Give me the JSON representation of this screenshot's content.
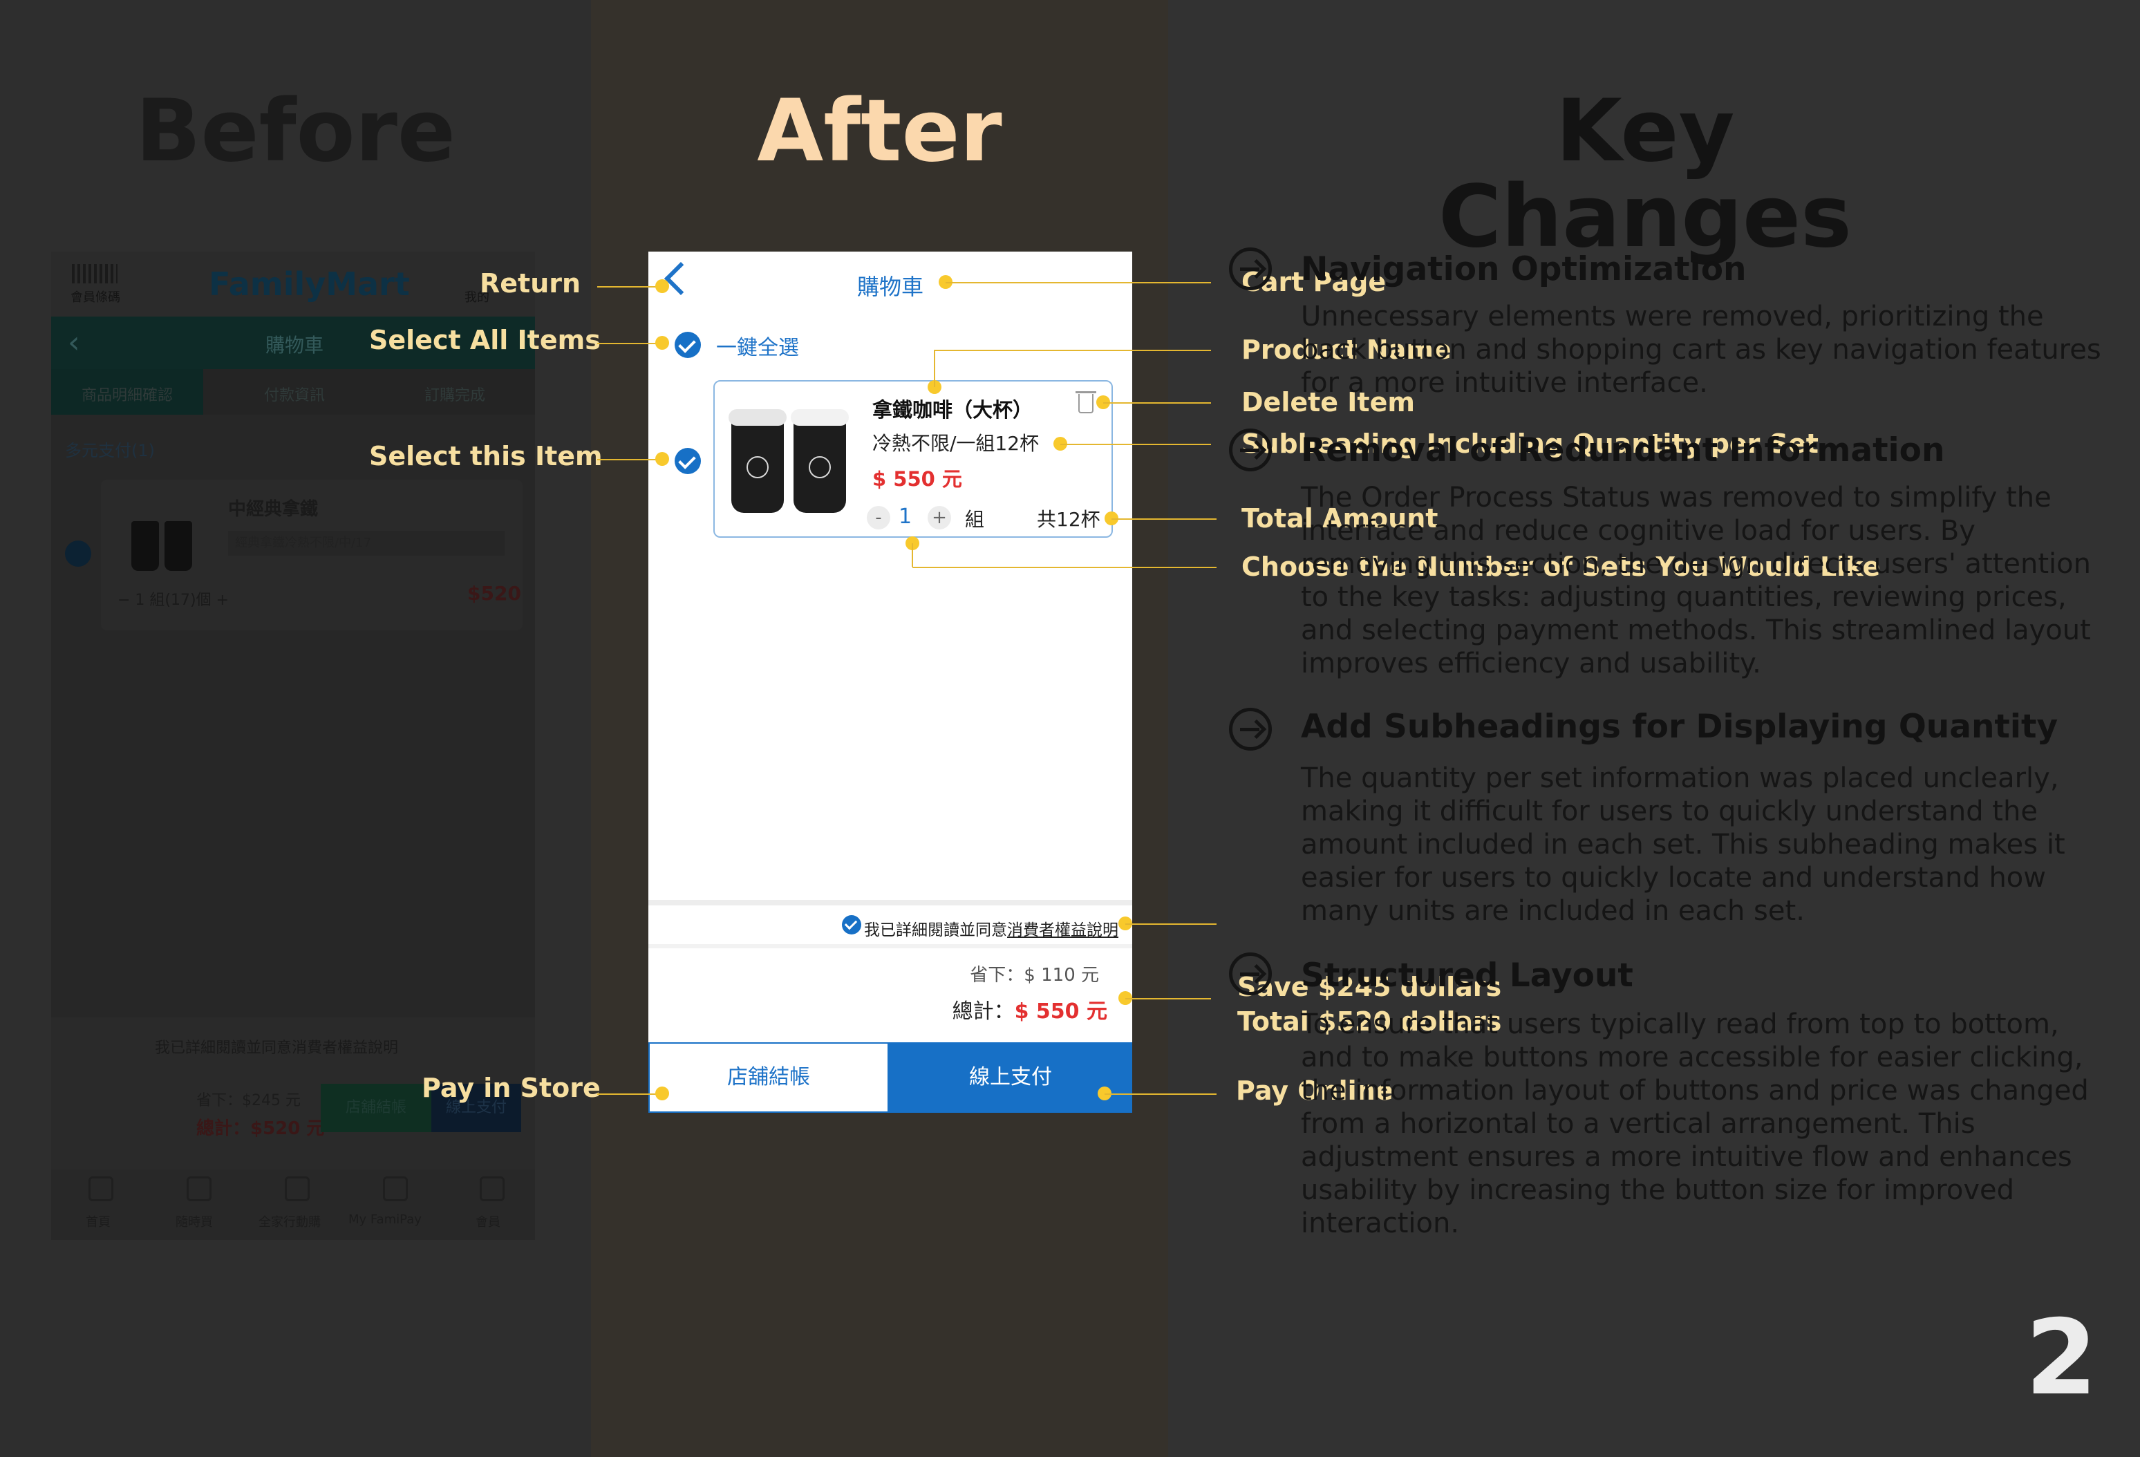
{
  "headings": {
    "before": "Before",
    "after": "After",
    "key_changes": "Key Changes"
  },
  "before_ui": {
    "barcode_caption": "會員條碼",
    "brand": "FamilyMart",
    "member_caption": "我的",
    "nav_title": "購物車",
    "steps": [
      "商品明細確認",
      "付款資訊",
      "訂購完成"
    ],
    "multi_pay": "多元支付(1)",
    "product_name": "中經典拿鐵",
    "product_subtitle": "經典拿鐵冷熱不限/中/17",
    "quantity_text": "−   1   組(17)個   +",
    "price": "$520",
    "agree_text": "我已詳細閱讀並同意消費者權益說明",
    "save_text": "省下：$245 元",
    "total_text": "總計：$520 元",
    "btn_store": "店舖結帳",
    "btn_online": "線上支付",
    "tabs": [
      "首頁",
      "隨時買",
      "全家行動購",
      "My FamiPay",
      "會員"
    ]
  },
  "after_ui": {
    "title": "購物車",
    "select_all": "一鍵全選",
    "product_name": "拿鐵咖啡（大杯）",
    "subheading": "冷熱不限/一組12杯",
    "price": "$ 550 元",
    "minus": "-",
    "quantity": "1",
    "plus": "+",
    "unit": "組",
    "total_cups": "共12杯",
    "agree_prefix": "我已詳細閱讀並同意",
    "agree_link": "消費者權益說明",
    "save_label": "省下：",
    "save_value": "$ 110 元",
    "total_label": "總計：",
    "total_value": "$ 550 元",
    "btn_store": "店舖結帳",
    "btn_online": "線上支付"
  },
  "callouts": {
    "return": "Return",
    "select_all": "Select All Items",
    "select_item": "Select this Item",
    "pay_store": "Pay in Store",
    "cart_page": "Cart Page",
    "product_name": "Product Name",
    "delete_item": "Delete Item",
    "subheading": "Subheading Including Quantity per Set",
    "total_amount": "Total Amount",
    "choose_sets": "Choose the Number of Sets You Would Like",
    "save": "Save $245 dollars",
    "total": "Total $520 dollars",
    "pay_online": "Pay Online"
  },
  "key_changes": [
    {
      "title": "Navigation Optimization",
      "body": "Unnecessary elements were removed, prioritizing the back button and shopping cart as key navigation features for a more intuitive interface."
    },
    {
      "title": "Removal of Redundant Information",
      "body": "The Order Process Status was removed to simplify the interface and reduce cognitive load for users. By removing this section, the design directs users' attention to the key tasks: adjusting quantities, reviewing prices, and selecting payment methods. This streamlined layout improves efficiency and usability."
    },
    {
      "title": "Add Subheadings for Displaying Quantity",
      "body": "The quantity per set information was placed unclearly, making it difficult for users to quickly understand the amount included in each set. This subheading makes it easier for users to quickly locate and understand how many units are included in each set."
    },
    {
      "title": "Structured Layout",
      "body": "To ensure that users typically read from top to bottom, and to make buttons more accessible for easier clicking, the information layout of buttons and price was changed from a horizontal to a vertical arrangement. This adjustment ensures a more intuitive flow and enhances usability by increasing the button size for improved interaction."
    }
  ],
  "page_number": "2",
  "colors": {
    "accent_blue": "#1770c6",
    "price_red": "#e33030",
    "callout_yellow": "#f8c92c",
    "after_title": "#fbd8ad"
  },
  "icons": [
    "barcode-icon",
    "back-icon",
    "check-icon",
    "trash-icon",
    "arrow-circle-icon",
    "cup-icon"
  ]
}
